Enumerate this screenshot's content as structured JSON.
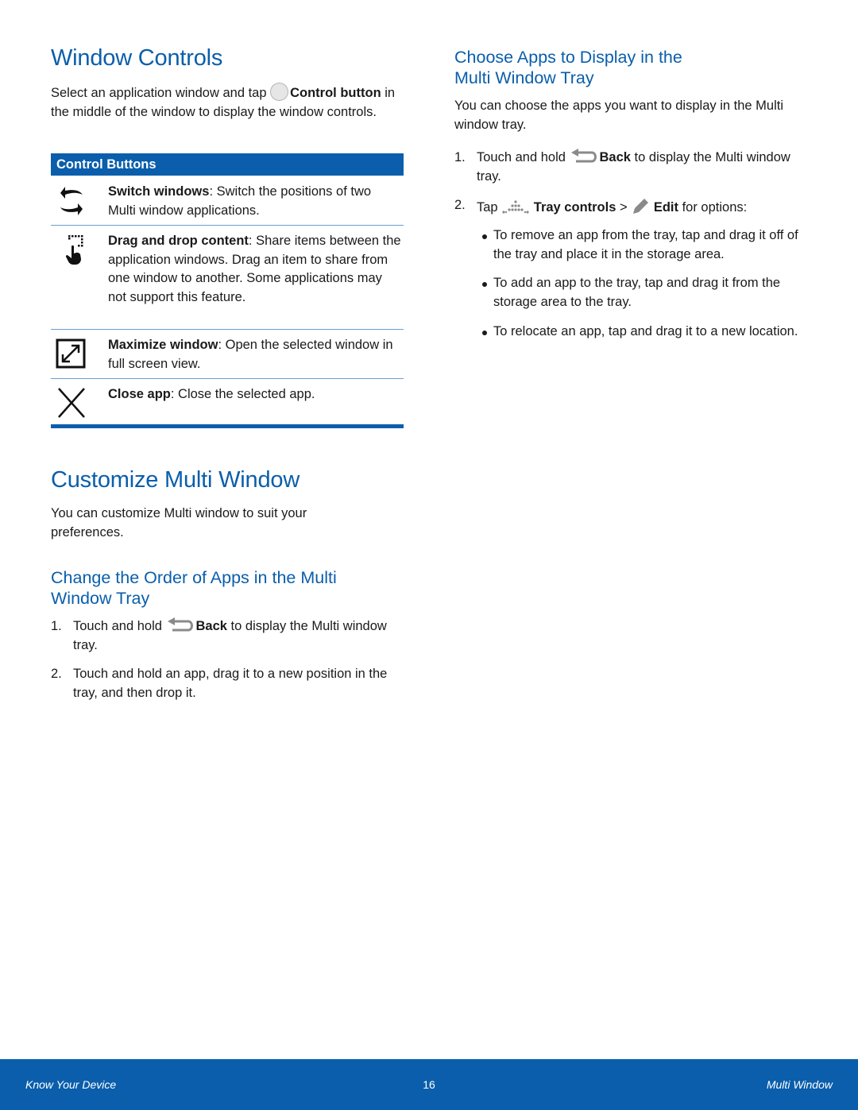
{
  "window_controls": {
    "title": "Window Controls",
    "intro_before": "Select an application window and tap ",
    "intro_bold": "Control button",
    "intro_after": " in the middle of the window to display the window controls.",
    "intro_icon": "control-button-circle-icon"
  },
  "control_buttons": {
    "header": "Control Buttons",
    "rows": [
      {
        "icon": "switch-windows-icon",
        "term": "Switch windows",
        "desc": ": Switch the positions of two Multi window applications."
      },
      {
        "icon": "drag-and-drop-icon",
        "term": "Drag and drop content",
        "desc": ": Share items between the application windows. Drag an item to share from one window to another. Some applications may not support this feature."
      },
      {
        "icon": "maximize-window-icon",
        "term": "Maximize window",
        "desc": ": Open the selected window in full screen view."
      },
      {
        "icon": "close-icon",
        "term": "Close app",
        "desc": ": Close the selected app."
      }
    ]
  },
  "customize": {
    "title": "Customize Multi Window",
    "intro": "You can customize Multi window to suit your preferences."
  },
  "change_order": {
    "title": "Change the Order of Apps in the Multi Window Tray",
    "steps": [
      {
        "num": "1.",
        "before": "Touch and hold ",
        "icon": "back-icon",
        "bold": "Back",
        "after": " to display the Multi window tray."
      },
      {
        "num": "2.",
        "text": "Touch and hold an app, drag it to a new position in the tray, and then drop it."
      }
    ]
  },
  "choose_apps": {
    "title": "Choose Apps to Display in the Multi Window Tray",
    "intro": "You can choose the apps you want to display in the Multi window tray.",
    "steps": [
      {
        "num": "1.",
        "before": "Touch and hold ",
        "icon": "back-icon",
        "bold": "Back",
        "after": " to display the Multi window tray."
      },
      {
        "num": "2.",
        "before": "Tap ",
        "icon1": "tray-controls-icon",
        "bold1": "Tray controls",
        "sep": " > ",
        "icon2": "pencil-edit-icon",
        "bold2": "Edit",
        "after": " for options:"
      }
    ],
    "bullets": [
      "To remove an app from the tray, tap and drag it off of the tray and place it in the storage area.",
      "To add an app to the tray, tap and drag it from the storage area to the tray.",
      "To relocate an app, tap and drag it to a new location."
    ]
  },
  "footer": {
    "left": "Know Your Device",
    "page": "16",
    "right": "Multi Window"
  },
  "colors": {
    "accent": "#0a5eab",
    "divider": "#6a9fd0",
    "text": "#1a1a1a",
    "icon_gray": "#8a8a8a"
  }
}
